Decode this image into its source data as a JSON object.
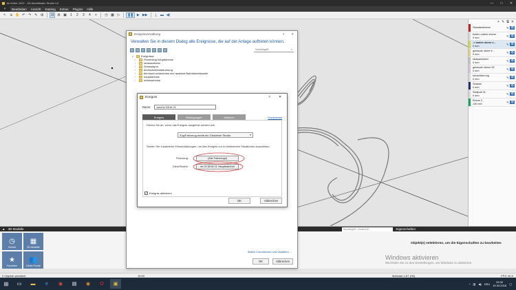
{
  "window": {
    "title": "Im Keller 1937 - 3D-Modellbahn Studio V4",
    "controls": [
      "—",
      "□",
      "✕"
    ]
  },
  "menu": {
    "back_label": "‹",
    "items": [
      "Bearbeiten",
      "Ansicht",
      "Katalog",
      "Extras",
      "Plugins",
      "Hilfe"
    ]
  },
  "toolbar": {
    "page_numbers": [
      "1",
      "2",
      "3",
      "4",
      "+"
    ]
  },
  "layers": {
    "header_icons": [
      "+",
      "✎",
      "⧉",
      "✕"
    ],
    "items": [
      {
        "name": "Standardebene",
        "sub": "",
        "color": "#c02020"
      },
      {
        "name": "boden untere ebene",
        "sub": "0 mm",
        "color": "#d9d9d9"
      },
      {
        "name": "-> boden obere e...",
        "sub": "0 mm",
        "color": "#c8d84a",
        "bold": true
      },
      {
        "name": "gebaude obere e...",
        "sub": "0 mm",
        "color": "#e0d080"
      },
      {
        "name": "strassenbahn",
        "sub": "0 mm",
        "color": "#c0c0c0"
      },
      {
        "name": "gebaude ebene 00",
        "sub": "0 mm",
        "color": "#d4bfe0"
      },
      {
        "name": "berschilterung",
        "sub": "0 mm",
        "color": "#d9d9d9"
      },
      {
        "name": "Strasse",
        "sub": "0 mm",
        "color": "#1f2f70"
      },
      {
        "name": "Stellpult 01",
        "sub": "0 mm",
        "color": "#d9d9d9"
      },
      {
        "name": "Ebene 2",
        "sub": "140 mm",
        "color": "#18a05a"
      }
    ],
    "eye_label": "👁"
  },
  "event_manager": {
    "title": "Ereignisverwaltung",
    "description": "Verwalten Sie in diesem Dialog alle Ereignisse, die auf der Anlage auftreten können.",
    "search_placeholder": "Suchbegriff",
    "tree": [
      {
        "label": "Ereignisse",
        "level": "root"
      },
      {
        "label": "Pendelzug hauptstrecke",
        "level": "child"
      },
      {
        "label": "strassenbahn",
        "level": "child"
      },
      {
        "label": "Schmalspur",
        "level": "child"
      },
      {
        "label": "drehscheibensteuerung",
        "level": "child"
      },
      {
        "label": "bbl.lauch nebenbahn ein/ ausfahrt Bahnbetriebswerk",
        "level": "child"
      },
      {
        "label": "hauptstrecke",
        "level": "child"
      },
      {
        "label": "nebenstrecke",
        "level": "child"
      }
    ],
    "link_label": "Aktive Countdowns und Variablen →",
    "ok_label": "OK",
    "cancel_label": "Abbrechen"
  },
  "event_dialog": {
    "title": "Ereignis",
    "name_label": "Name:",
    "name_value": "weiche DKW 01",
    "tabs": [
      "Ereignis",
      "Bedingungen",
      "Aktionen"
    ],
    "comment_link": "Kommentar",
    "event_prompt": "Geben Sie an, wenn das Ereignis ausgelöst werden soll.",
    "event_select": "Zug/Fahrzeug betritt ein Gleis/eine Straße",
    "restrict_text": "Setzen Sie zusätzliche Einschränkungen, um das Ereignis nur in bestimmten Situationen auszulösen.",
    "vehicle_label": "Fahrzeug:",
    "vehicle_value": "[Alle Fahrzeuge]",
    "track_label": "Gleis/Straße:",
    "track_value": "ek 01 DKW 01 Hauptbahnhof",
    "active_label": "Ereignis aktivieren",
    "ok_label": "OK",
    "cancel_label": "Abbrechen"
  },
  "bottom": {
    "title": "3D-Modelle",
    "search_placeholder": "Suchbegriff / Content-ID",
    "properties_title": "Eigenschaften",
    "tiles": [
      "Verlauf",
      "3D-Modelle",
      "Favoriten",
      "Deine Funde"
    ],
    "properties_message": "Objekt(e) selektieren, um die Eigenschaften zu bearbeiten",
    "windows_title": "Windows aktivieren",
    "windows_sub": "Wechseln Sie zu den Einstellungen, um Windows zu aktivieren."
  },
  "status": {
    "selected": "0 Objekte selektiert",
    "time": "15:00",
    "scale": "Maßstab 1:87 (H0)",
    "fps": "FPS: 60,0"
  },
  "taskbar": {
    "lang": "DEU",
    "time": "09:32",
    "date": "15.03.2018"
  }
}
